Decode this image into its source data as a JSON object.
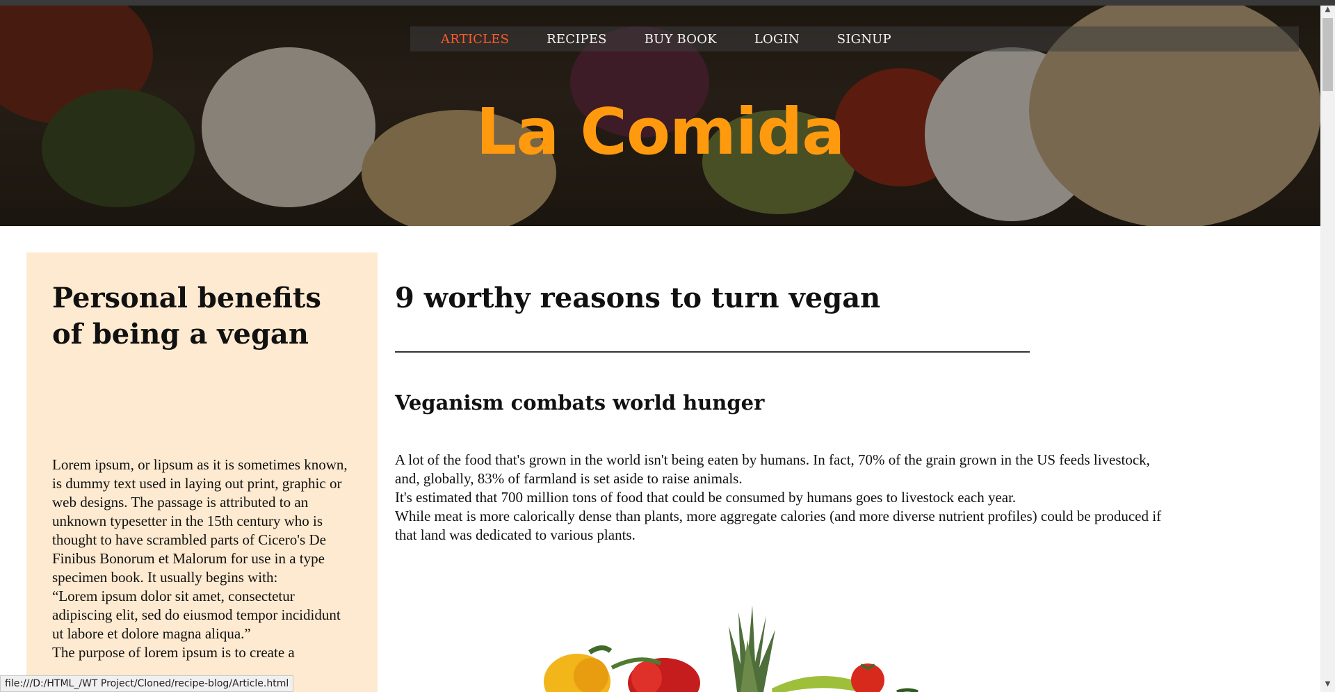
{
  "nav": {
    "items": [
      {
        "label": "ARTICLES",
        "active": true
      },
      {
        "label": "RECIPES",
        "active": false
      },
      {
        "label": "BUY BOOK",
        "active": false
      },
      {
        "label": "LOGIN",
        "active": false
      },
      {
        "label": "SIGNUP",
        "active": false
      }
    ]
  },
  "hero": {
    "title": "La Comida"
  },
  "sidebar": {
    "heading": "Personal benefits of being a vegan",
    "paragraphs": [
      "Lorem ipsum, or lipsum as it is sometimes known, is dummy text used in laying out print, graphic or web designs. The passage is attributed to an unknown typesetter in the 15th century who is thought to have scrambled parts of Cicero's De Finibus Bonorum et Malorum for use in a type specimen book. It usually begins with:",
      "“Lorem ipsum dolor sit amet, consectetur adipiscing elit, sed do eiusmod tempor incididunt ut labore et dolore magna aliqua.”",
      "The purpose of lorem ipsum is to create a"
    ]
  },
  "article": {
    "title": "9 worthy reasons to turn vegan",
    "section_heading": "Veganism combats world hunger",
    "paragraphs": [
      "A lot of the food that's grown in the world isn't being eaten by humans. In fact, 70% of the grain grown in the US feeds livestock, and, globally, 83% of farmland is set aside to raise animals.",
      "It's estimated that 700 million tons of food that could be consumed by humans goes to livestock each year.",
      "While meat is more calorically dense than plants, more aggregate calories (and more diverse nutrient profiles) could be produced if that land was dedicated to various plants."
    ]
  },
  "statusbar": {
    "url": "file:///D:/HTML_/WT Project/Cloned/recipe-blog/Article.html"
  },
  "scrollbar": {
    "up_glyph": "▲",
    "down_glyph": "▼"
  },
  "colors": {
    "title": "#ff9a0e",
    "active_nav": "#ff5a2a",
    "sidebar_bg": "#feead0"
  }
}
